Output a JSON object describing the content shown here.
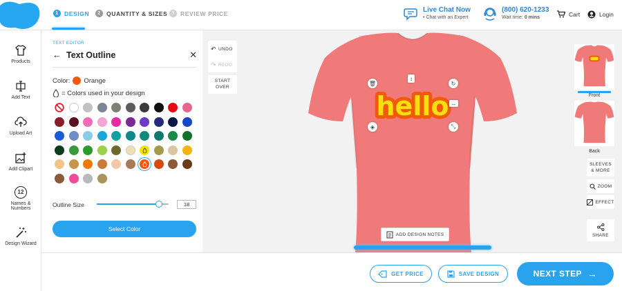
{
  "header": {
    "steps": [
      {
        "num": "1",
        "label": "DESIGN"
      },
      {
        "num": "2",
        "label": "QUANTITY & SIZES"
      },
      {
        "num": "3",
        "label": "REVIEW PRICE"
      }
    ],
    "chat_title": "Live Chat Now",
    "chat_sub": "• Chat with an Expert",
    "phone": "(800) 620-1233",
    "wait_label": "Wait time:",
    "wait_value": "0 mins",
    "cart": "Cart",
    "login": "Login"
  },
  "rail": [
    {
      "label": "Products",
      "icon": "tshirt-icon"
    },
    {
      "label": "Add Text",
      "icon": "text-icon"
    },
    {
      "label": "Upload Art",
      "icon": "cloud-upload-icon"
    },
    {
      "label": "Add Clipart",
      "icon": "clipart-icon"
    },
    {
      "label": "Names &",
      "label2": "Numbers",
      "badge": "12",
      "icon": "numbers-icon"
    },
    {
      "label": "Design Wizard",
      "icon": "magic-wand-icon"
    }
  ],
  "editor": {
    "kicker": "TEXT EDITOR",
    "title": "Text Outline",
    "color_label": "Color:",
    "color_name": "Orange",
    "color_hex": "#f15a0a",
    "used_label": "= Colors used in your design",
    "outline_label": "Outline Size",
    "outline_value": "18",
    "outline_fraction": 0.87,
    "select_button": "Select Color"
  },
  "swatches": [
    "none",
    "#ffffff",
    "#c2c2c2",
    "#7a8694",
    "#7f7f76",
    "#5c5c5c",
    "#3a3a3a",
    "#111111",
    "#e60c14",
    "#e8678b",
    "#8c1c2c",
    "#5a1020",
    "#f06bb8",
    "#f2a6d0",
    "#e62aa0",
    "#7a2a92",
    "#6d3ac8",
    "#2a2a7a",
    "#0a1848",
    "#1448c8",
    "#1a5cd6",
    "#6e8cc8",
    "#8acbe8",
    "#1aa6d6",
    "#14a0a0",
    "#0c8a8a",
    "#10887a",
    "#0f7a6a",
    "#1a8a4a",
    "#15702a",
    "#0e3a1e",
    "#3a9a3a",
    "#2a9a2a",
    "#9ad04a",
    "#6a6a2a",
    "#ece0b4",
    "#f8e010",
    "#a69a4a",
    "#dcc4a0",
    "#f5b414",
    "#f4c48a",
    "#c8964a",
    "#f0780a",
    "#c87a3a",
    "#f2c8a8",
    "#a87a5a",
    "#f15a0a",
    "#d84a10",
    "#8a5a3a",
    "#6a3a1a",
    "#8a5a3a",
    "#f04a9a",
    "#b8b8c0",
    "#a8945a"
  ],
  "selected_swatch": 46,
  "used_swatch": 36,
  "canvas": {
    "undo": "UNDO",
    "redo": "REDO",
    "start_over_1": "START",
    "start_over_2": "OVER",
    "design_text": "hello",
    "design_notes": "ADD DESIGN NOTES",
    "shirt_color": "#f07a7a",
    "front": "Front",
    "back": "Back",
    "sleeves_1": "SLEEVES",
    "sleeves_2": "& MORE",
    "zoom": "ZOOM",
    "effect": "EFFECT",
    "share": "SHARE"
  },
  "bottom": {
    "get_price": "GET PRICE",
    "save_design": "SAVE DESIGN",
    "next_step": "NEXT STEP"
  },
  "colors": {
    "accent": "#2aa3ef",
    "logo": "#27a7f0"
  }
}
